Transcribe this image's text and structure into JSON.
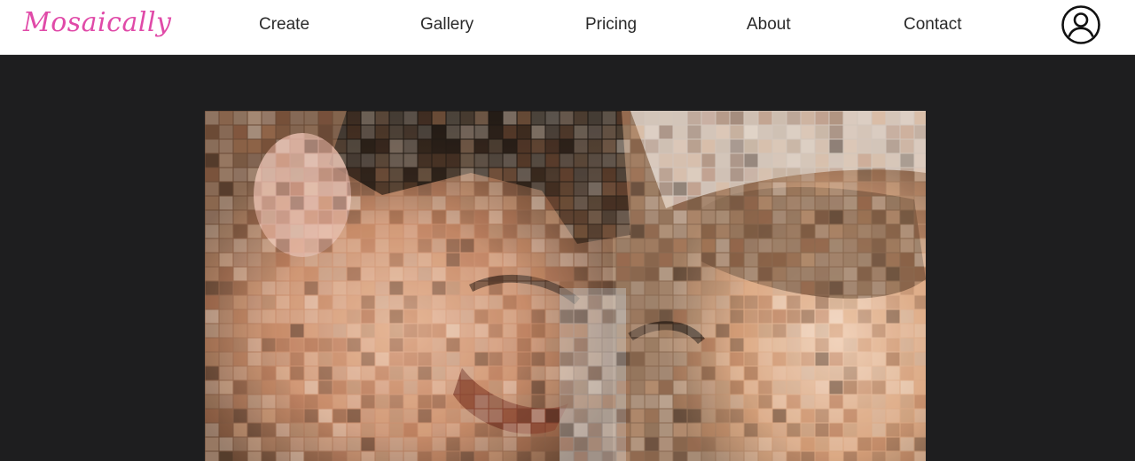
{
  "header": {
    "logo_text": "Mosaically",
    "logo_color": "#e04aa8",
    "nav": [
      {
        "label": "Create"
      },
      {
        "label": "Gallery"
      },
      {
        "label": "Pricing"
      },
      {
        "label": "About"
      },
      {
        "label": "Contact"
      }
    ],
    "account_icon": "user-circle-icon"
  },
  "colors": {
    "page_background": "#1e1e1f",
    "header_background": "#ffffff",
    "nav_text": "#2a2a2a"
  }
}
